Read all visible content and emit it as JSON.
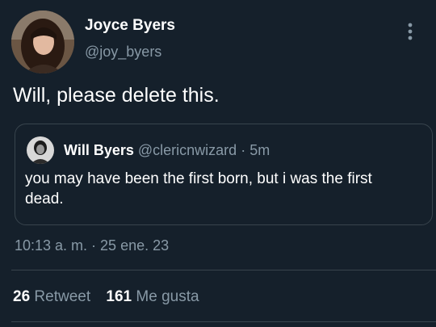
{
  "author": {
    "name": "Joyce Byers",
    "handle": "@joy_byers"
  },
  "tweet": {
    "text": "Will, please delete this."
  },
  "quote": {
    "name": "Will Byers",
    "handle": "@clericnwizard",
    "separator": "·",
    "age": "5m",
    "text": "you may have been the first born, but i was the first dead."
  },
  "meta": {
    "timestamp": "10:13 a. m. · 25 ene. 23"
  },
  "stats": {
    "retweets_count": "26",
    "retweets_label": "Retweet",
    "likes_count": "161",
    "likes_label": "Me gusta"
  },
  "colors": {
    "background": "#15202b",
    "border": "#38444d",
    "secondary_text": "#8899a6"
  }
}
